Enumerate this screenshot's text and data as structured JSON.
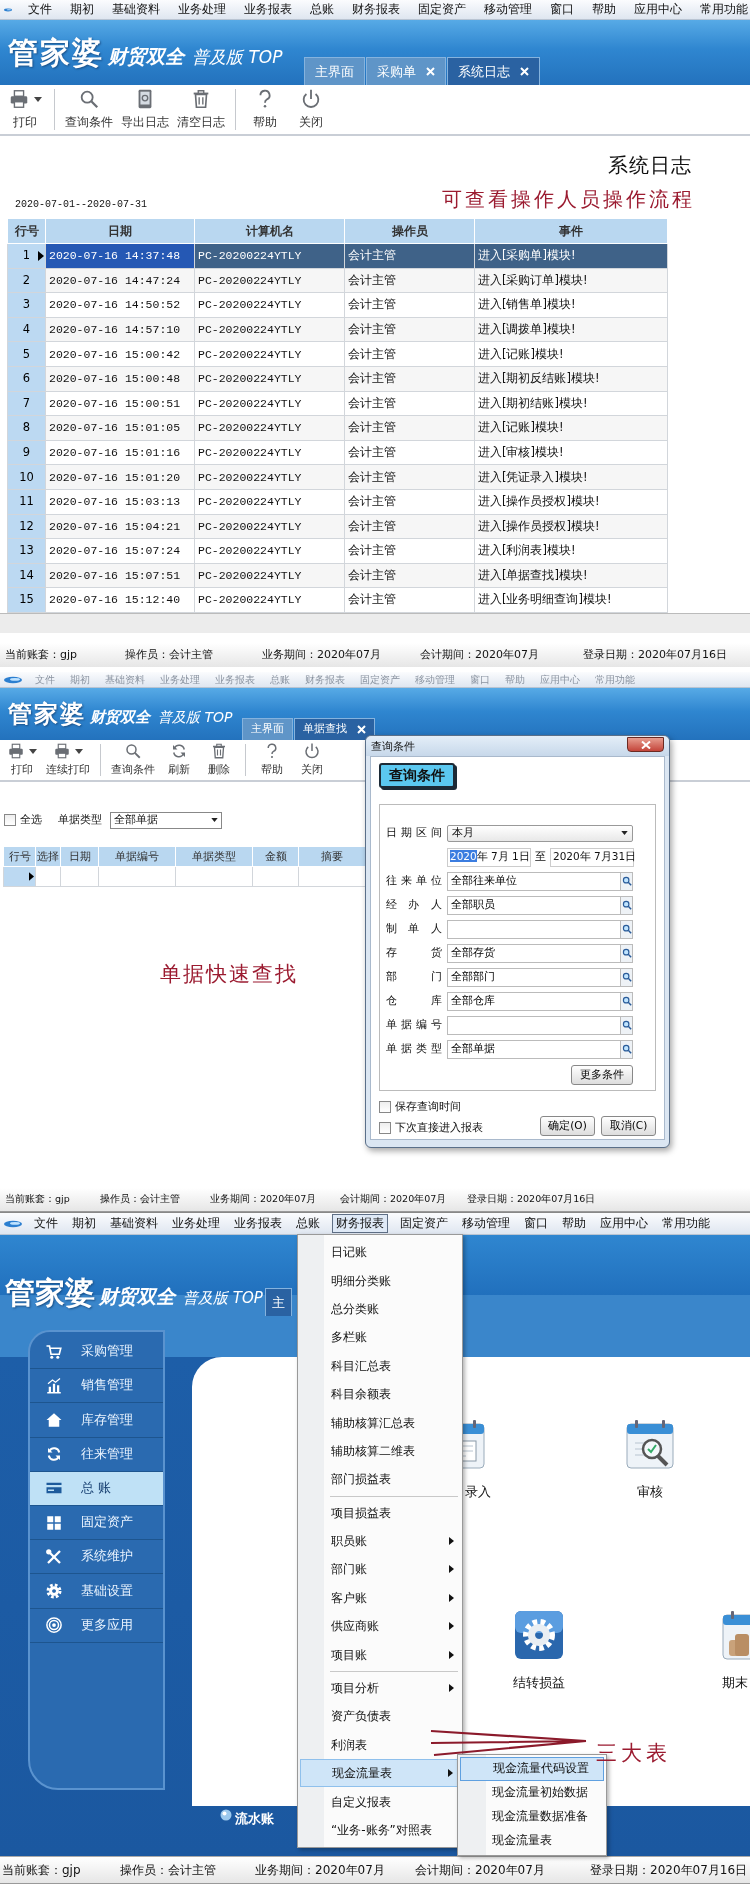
{
  "log_screen": {
    "menu_dimmed": false,
    "menu_bar": [
      {
        "label": "文件",
        "selected": false
      },
      {
        "label": "期初",
        "selected": false
      },
      {
        "label": "基础资料",
        "selected": false
      },
      {
        "label": "业务处理",
        "selected": false
      },
      {
        "label": "业务报表",
        "selected": false
      },
      {
        "label": "总账",
        "selected": false
      },
      {
        "label": "财务报表",
        "selected": false
      },
      {
        "label": "固定资产",
        "selected": false
      },
      {
        "label": "移动管理",
        "selected": false
      },
      {
        "label": "窗口",
        "selected": false
      },
      {
        "label": "帮助",
        "selected": false
      },
      {
        "label": "应用中心",
        "selected": false
      },
      {
        "label": "常用功能",
        "selected": false
      }
    ],
    "logo": {
      "name": "管家婆",
      "slogan": "财贸双全",
      "edition": "普及版 TOP"
    },
    "tabs": [
      {
        "label": "主界面",
        "closable": false,
        "selected": false
      },
      {
        "label": "采购单",
        "closable": true,
        "selected": false
      },
      {
        "label": "系统日志",
        "closable": true,
        "selected": true
      }
    ],
    "toolbar_groups": [
      [
        {
          "kind": "print",
          "label": "打印",
          "dropdown": true
        }
      ],
      [
        {
          "kind": "search",
          "label": "查询条件",
          "dropdown": false
        },
        {
          "kind": "export",
          "label": "导出日志",
          "dropdown": false
        },
        {
          "kind": "clear",
          "label": "清空日志",
          "dropdown": false
        }
      ],
      [
        {
          "kind": "help",
          "label": "帮助",
          "dropdown": false
        },
        {
          "kind": "close",
          "label": "关闭",
          "dropdown": false
        }
      ]
    ],
    "report_title": "系统日志",
    "date_range": "2020-07-01--2020-07-31",
    "annotation": "可查看操作人员操作流程",
    "table": {
      "columns": [
        "行号",
        "日期",
        "计算机名",
        "操作员",
        "事件"
      ],
      "rows": [
        {
          "row_number": "1",
          "date": "2020-07-16 14:37:48",
          "computer": "PC-20200224YTLY",
          "operator": "会计主管",
          "event": "进入[采购单]模块!",
          "selected": true
        },
        {
          "row_number": "2",
          "date": "2020-07-16 14:47:24",
          "computer": "PC-20200224YTLY",
          "operator": "会计主管",
          "event": "进入[采购订单]模块!",
          "selected": false
        },
        {
          "row_number": "3",
          "date": "2020-07-16 14:50:52",
          "computer": "PC-20200224YTLY",
          "operator": "会计主管",
          "event": "进入[销售单]模块!",
          "selected": false
        },
        {
          "row_number": "4",
          "date": "2020-07-16 14:57:10",
          "computer": "PC-20200224YTLY",
          "operator": "会计主管",
          "event": "进入[调拨单]模块!",
          "selected": false
        },
        {
          "row_number": "5",
          "date": "2020-07-16 15:00:42",
          "computer": "PC-20200224YTLY",
          "operator": "会计主管",
          "event": "进入[记账]模块!",
          "selected": false
        },
        {
          "row_number": "6",
          "date": "2020-07-16 15:00:48",
          "computer": "PC-20200224YTLY",
          "operator": "会计主管",
          "event": "进入[期初反结账]模块!",
          "selected": false
        },
        {
          "row_number": "7",
          "date": "2020-07-16 15:00:51",
          "computer": "PC-20200224YTLY",
          "operator": "会计主管",
          "event": "进入[期初结账]模块!",
          "selected": false
        },
        {
          "row_number": "8",
          "date": "2020-07-16 15:01:05",
          "computer": "PC-20200224YTLY",
          "operator": "会计主管",
          "event": "进入[记账]模块!",
          "selected": false
        },
        {
          "row_number": "9",
          "date": "2020-07-16 15:01:16",
          "computer": "PC-20200224YTLY",
          "operator": "会计主管",
          "event": "进入[审核]模块!",
          "selected": false
        },
        {
          "row_number": "10",
          "date": "2020-07-16 15:01:20",
          "computer": "PC-20200224YTLY",
          "operator": "会计主管",
          "event": "进入[凭证录入]模块!",
          "selected": false
        },
        {
          "row_number": "11",
          "date": "2020-07-16 15:03:13",
          "computer": "PC-20200224YTLY",
          "operator": "会计主管",
          "event": "进入[操作员授权]模块!",
          "selected": false
        },
        {
          "row_number": "12",
          "date": "2020-07-16 15:04:21",
          "computer": "PC-20200224YTLY",
          "operator": "会计主管",
          "event": "进入[操作员授权]模块!",
          "selected": false
        },
        {
          "row_number": "13",
          "date": "2020-07-16 15:07:24",
          "computer": "PC-20200224YTLY",
          "operator": "会计主管",
          "event": "进入[利润表]模块!",
          "selected": false
        },
        {
          "row_number": "14",
          "date": "2020-07-16 15:07:51",
          "computer": "PC-20200224YTLY",
          "operator": "会计主管",
          "event": "进入[单据查找]模块!",
          "selected": false
        },
        {
          "row_number": "15",
          "date": "2020-07-16 15:12:40",
          "computer": "PC-20200224YTLY",
          "operator": "会计主管",
          "event": "进入[业务明细查询]模块!",
          "selected": false
        }
      ]
    },
    "status_bar": [
      "当前账套：gjp",
      "操作员：会计主管",
      "业务期间：2020年07月",
      "会计期间：2020年07月",
      "登录日期：2020年07月16日"
    ]
  },
  "bill_search_screen": {
    "menu_dimmed": true,
    "menu_bar": [
      {
        "label": "文件",
        "selected": false
      },
      {
        "label": "期初",
        "selected": false
      },
      {
        "label": "基础资料",
        "selected": false
      },
      {
        "label": "业务处理",
        "selected": false
      },
      {
        "label": "业务报表",
        "selected": false
      },
      {
        "label": "总账",
        "selected": false
      },
      {
        "label": "财务报表",
        "selected": false
      },
      {
        "label": "固定资产",
        "selected": false
      },
      {
        "label": "移动管理",
        "selected": false
      },
      {
        "label": "窗口",
        "selected": false
      },
      {
        "label": "帮助",
        "selected": false
      },
      {
        "label": "应用中心",
        "selected": false
      },
      {
        "label": "常用功能",
        "selected": false
      }
    ],
    "logo": {
      "name": "管家婆",
      "slogan": "财贸双全",
      "edition": "普及版 TOP"
    },
    "tabs": [
      {
        "label": "主界面",
        "closable": false,
        "selected": false
      },
      {
        "label": "单据查找",
        "closable": true,
        "selected": true
      }
    ],
    "toolbar_groups": [
      [
        {
          "kind": "print",
          "label": "打印",
          "dropdown": true
        },
        {
          "kind": "print",
          "label": "连续打印",
          "dropdown": true
        }
      ],
      [
        {
          "kind": "search",
          "label": "查询条件",
          "dropdown": false
        },
        {
          "kind": "refresh",
          "label": "刷新",
          "dropdown": false
        },
        {
          "kind": "delete",
          "label": "删除",
          "dropdown": false
        }
      ],
      [
        {
          "kind": "help",
          "label": "帮助",
          "dropdown": false
        },
        {
          "kind": "close",
          "label": "关闭",
          "dropdown": false
        }
      ]
    ],
    "filter": {
      "select_all": {
        "label": "全选",
        "checked": false
      },
      "bill_type": {
        "label": "单据类型",
        "value": "全部单据"
      }
    },
    "grid": {
      "columns": [
        "行号",
        "选择",
        "日期",
        "单据编号",
        "单据类型",
        "金额",
        "摘要"
      ],
      "rows": [
        {
          "current": true
        }
      ]
    },
    "annotation": "单据快速查找",
    "dialog": {
      "title": "查询条件",
      "heading": "查询条件",
      "date_range": {
        "label": "日期区间",
        "value": "本月"
      },
      "from": {
        "selected_text": "2020",
        "text": "年 7月 1日"
      },
      "separator": "至",
      "to": "2020年 7月31日",
      "fields": [
        {
          "label": "往来单位",
          "value": "全部往来单位"
        },
        {
          "label": "经 办 人",
          "value": "全部职员"
        },
        {
          "label": "制 单 人"
        },
        {
          "label": "存 货",
          "value": "全部存货"
        },
        {
          "label": "部 门",
          "value": "全部部门"
        },
        {
          "label": "仓 库",
          "value": "全部仓库"
        },
        {
          "label": "单据编号"
        },
        {
          "label": "单据类型",
          "value": "全部单据"
        }
      ],
      "more_button": "更多条件",
      "options": [
        {
          "label": "保存查询时间",
          "checked": false
        },
        {
          "label": "下次直接进入报表",
          "checked": false
        }
      ],
      "buttons": [
        "确定(O)",
        "取消(C)"
      ]
    },
    "status_bar": [
      "当前账套：gjp",
      "操作员：会计主管",
      "业务期间：2020年07月",
      "会计期间：2020年07月",
      "登录日期：2020年07月16日"
    ]
  },
  "finance_screen": {
    "menu_dimmed": false,
    "menu_bar": [
      {
        "label": "文件",
        "selected": false
      },
      {
        "label": "期初",
        "selected": false
      },
      {
        "label": "基础资料",
        "selected": false
      },
      {
        "label": "业务处理",
        "selected": false
      },
      {
        "label": "业务报表",
        "selected": false
      },
      {
        "label": "总账",
        "selected": false
      },
      {
        "label": "财务报表",
        "selected": true
      },
      {
        "label": "固定资产",
        "selected": false
      },
      {
        "label": "移动管理",
        "selected": false
      },
      {
        "label": "窗口",
        "selected": false
      },
      {
        "label": "帮助",
        "selected": false
      },
      {
        "label": "应用中心",
        "selected": false
      },
      {
        "label": "常用功能",
        "selected": false
      }
    ],
    "logo": {
      "name": "管家婆",
      "slogan": "财贸双全",
      "edition": "普及版 TOP"
    },
    "tabs": [
      {
        "label": "主",
        "closable": false,
        "selected": true
      }
    ],
    "sidebar": [
      {
        "kind": "cart",
        "label": "采购管理",
        "selected": false
      },
      {
        "kind": "chart",
        "label": "销售管理",
        "selected": false
      },
      {
        "kind": "home",
        "label": "库存管理",
        "selected": false
      },
      {
        "kind": "cycle",
        "label": "往来管理",
        "selected": false
      },
      {
        "kind": "card",
        "label": "总 账",
        "selected": true
      },
      {
        "kind": "grid",
        "label": "固定资产",
        "selected": false
      },
      {
        "kind": "tools",
        "label": "系统维护",
        "selected": false
      },
      {
        "kind": "gear",
        "label": "基础设置",
        "selected": false
      },
      {
        "kind": "target",
        "label": "更多应用",
        "selected": false
      }
    ],
    "tiles": [
      {
        "kind": "entry",
        "label": "录入"
      },
      {
        "kind": "audit",
        "label": "审核"
      },
      {
        "kind": "carry",
        "label": "结转损益"
      },
      {
        "kind": "period",
        "label": "期末"
      }
    ],
    "footer": "流水账",
    "dropdown": {
      "groups": [
        [
          {
            "label": "日记账",
            "submenu": false,
            "selected": false
          },
          {
            "label": "明细分类账",
            "submenu": false,
            "selected": false
          },
          {
            "label": "总分类账",
            "submenu": false,
            "selected": false
          },
          {
            "label": "多栏账",
            "submenu": false,
            "selected": false
          },
          {
            "label": "科目汇总表",
            "submenu": false,
            "selected": false
          },
          {
            "label": "科目余额表",
            "submenu": false,
            "selected": false
          },
          {
            "label": "辅助核算汇总表",
            "submenu": false,
            "selected": false
          },
          {
            "label": "辅助核算二维表",
            "submenu": false,
            "selected": false
          },
          {
            "label": "部门损益表",
            "submenu": false,
            "selected": false
          }
        ],
        [
          {
            "label": "项目损益表",
            "submenu": false,
            "selected": false
          },
          {
            "label": "职员账",
            "submenu": true,
            "selected": false
          },
          {
            "label": "部门账",
            "submenu": true,
            "selected": false
          },
          {
            "label": "客户账",
            "submenu": true,
            "selected": false
          },
          {
            "label": "供应商账",
            "submenu": true,
            "selected": false
          },
          {
            "label": "项目账",
            "submenu": true,
            "selected": false
          }
        ],
        [
          {
            "label": "项目分析",
            "submenu": true,
            "selected": false
          },
          {
            "label": "资产负债表",
            "submenu": false,
            "selected": false
          },
          {
            "label": "利润表",
            "submenu": false,
            "selected": false
          },
          {
            "label": "现金流量表",
            "submenu": true,
            "selected": true
          },
          {
            "label": "自定义报表",
            "submenu": false,
            "selected": false
          },
          {
            "label": "“业务-账务”对照表",
            "submenu": false,
            "selected": false
          }
        ]
      ]
    },
    "submenu": [
      {
        "label": "现金流量代码设置",
        "selected": true
      },
      {
        "label": "现金流量初始数据",
        "selected": false
      },
      {
        "label": "现金流量数据准备",
        "selected": false
      },
      {
        "label": "现金流量表",
        "selected": false
      }
    ],
    "annotation": "三大表",
    "status_bar": [
      "当前账套：gjp",
      "操作员：会计主管",
      "业务期间：2020年07月",
      "会计期间：2020年07月",
      "登录日期：2020年07月16日"
    ]
  }
}
